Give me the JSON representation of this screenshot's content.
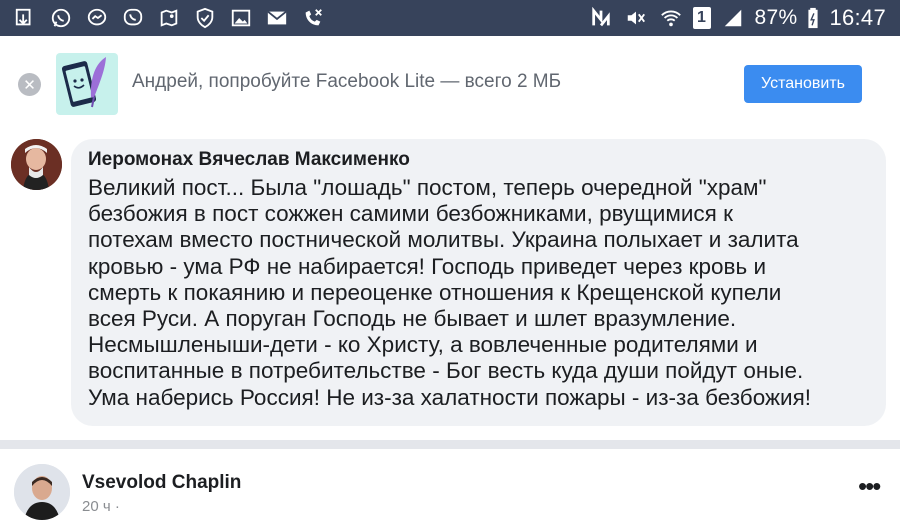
{
  "status_bar": {
    "battery": "87%",
    "time": "16:47",
    "sim": "1",
    "left_icons": [
      "download-arrow-icon",
      "whatsapp-icon",
      "messenger-icon",
      "viber-icon",
      "location-icon",
      "shield-icon",
      "gallery-icon",
      "mail-icon",
      "missed-call-icon"
    ],
    "right_icons": [
      "nfc-icon",
      "mute-icon",
      "wifi-icon",
      "sim-icon",
      "signal-icon",
      "battery-charging-icon"
    ]
  },
  "promo": {
    "text": "Андрей, попробуйте Facebook Lite — всего 2 МБ",
    "button": "Установить",
    "accent": "#3b8cf0"
  },
  "comment": {
    "author": "Иеромонах Вячеслав Максименко",
    "text": "Великий пост... Была \"лошадь\" постом, теперь очередной \"храм\"\nбезбожия в пост сожжен самими безбожниками, рвущимися к\nпотехам вместо постнической молитвы. Украина полыхает и залита\nкровью - ума РФ не набирается! Господь приведет через кровь и\nсмерть к покаянию и переоценке отношения к Крещенской купели\nвсея Руси. А поруган Господь не бывает и шлет вразумление.\nНесмышленыши-дети - ко Христу, а вовлеченные родителями и\nвоспитанные в потребительстве - Бог весть куда души пойдут оные.\nУма наберись Россия! Не из-за халатности пожары - из-за безбожия!"
  },
  "next_post": {
    "author": "Vsevolod Chaplin",
    "time": "20 ч ·",
    "more": "•••"
  }
}
